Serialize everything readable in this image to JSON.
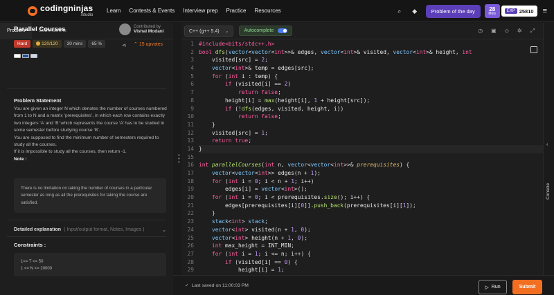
{
  "header": {
    "logo_name": "codingninjas",
    "logo_sub": "/studio",
    "nav": [
      "Learn",
      "Contests & Events",
      "Interview prep",
      "Practice",
      "Resources"
    ],
    "potd_label": "Problem of the day",
    "streak_count": "28",
    "streak_unit": "Mins",
    "exp_tag": "EXP",
    "exp_value": "25810"
  },
  "left": {
    "tabs": [
      "Problem",
      "Submissions"
    ],
    "title": "Parallel Courses",
    "contributed_by_label": "Contributed by",
    "contributor": "Vishal Modani",
    "difficulty": "Hard",
    "score": "120/120",
    "time": "30 mins",
    "success": "65 %",
    "upvotes": "15 upvotes",
    "statement_heading": "Problem Statement",
    "statement": [
      "You are given an integer N which denotes the number of courses numbered from 1 to N and a matrix ‘prerequisites’, in which each row contains exactly two integers ‘A’ and ‘B’ which represents the course ‘A’ has to be studied in some semester before studying course ‘B’.",
      "You are supposed to find the minimum number of semesters required to study all the courses.",
      "If it is impossible to study all the courses, then return -1."
    ],
    "note_heading": "Note :",
    "note": "There is no limitation on taking the number of courses in a particular semester as long as all the prerequisites for taking the course are satisfied.",
    "detailed_label": "Detailed explanation",
    "detailed_hint": "( Input/output format, Notes, Images )",
    "constraints_heading": "Constraints :",
    "constraints": [
      "1<= T <= 50",
      "1 <= N <= 20000"
    ]
  },
  "editor": {
    "language": "C++ (g++ 5.4)",
    "autocomplete_label": "Autocomplete",
    "autocomplete_on": true,
    "code_lines": [
      "#include<bits/stdc++.h>",
      "bool dfs(vector<vector<int>>& edges, vector<int>& visited, vector<int>& height, int",
      "    visited[src] = 2;",
      "    vector<int>& temp = edges[src];",
      "    for (int i : temp) {",
      "        if (visited[i] == 2)",
      "            return false;",
      "        height[i] = max(height[i], 1 + height[src]);",
      "        if (!dfs(edges, visited, height, i))",
      "            return false;",
      "    }",
      "    visited[src] = 1;",
      "    return true;",
      "}",
      "",
      "int parallelCourses(int n, vector<vector<int>>& prerequisites) {",
      "    vector<vector<int>> edges(n + 1);",
      "    for (int i = 0; i < n + 1; i++)",
      "        edges[i] = vector<int>();",
      "    for (int i = 0; i < prerequisites.size(); i++) {",
      "        edges[prerequisites[i][0]].push_back(prerequisites[i][1]);",
      "    }",
      "    stack<int> stack;",
      "    vector<int> visited(n + 1, 0);",
      "    vector<int> height(n + 1, 0);",
      "    int max_height = INT_MIN;",
      "    for (int i = 1; i <= n; i++) {",
      "        if (visited[i] == 0) {",
      "            height[i] = 1;"
    ]
  },
  "console_label": "Console",
  "footer": {
    "saved_text": "Last saved on 11:00:03 PM",
    "run_label": "Run",
    "submit_label": "Submit"
  },
  "colors": {
    "accent": "#f26f21",
    "purple": "#5b3fb8",
    "hard": "#c0392b"
  }
}
